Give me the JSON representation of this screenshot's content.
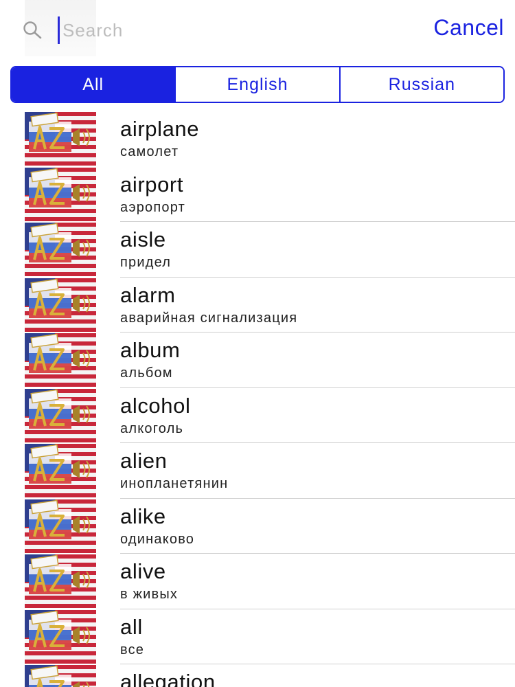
{
  "search": {
    "placeholder": "Search",
    "value": "",
    "cancel_label": "Cancel"
  },
  "segments": [
    {
      "label": "All",
      "selected": true
    },
    {
      "label": "English",
      "selected": false
    },
    {
      "label": "Russian",
      "selected": false
    }
  ],
  "colors": {
    "accent": "#1a22e0",
    "divider": "#cfcfcf",
    "text": "#111111"
  },
  "thumbnail_icon": "az-dictionary-flag-icon",
  "words": [
    {
      "word": "airplane",
      "translation": "самолет"
    },
    {
      "word": "airport",
      "translation": "аэропорт"
    },
    {
      "word": "aisle",
      "translation": "придел"
    },
    {
      "word": "alarm",
      "translation": "аварийная сигнализация"
    },
    {
      "word": "album",
      "translation": "альбом"
    },
    {
      "word": "alcohol",
      "translation": "алкоголь"
    },
    {
      "word": "alien",
      "translation": "инопланетянин"
    },
    {
      "word": "alike",
      "translation": "одинаково"
    },
    {
      "word": "alive",
      "translation": "в живых"
    },
    {
      "word": "all",
      "translation": "все"
    },
    {
      "word": "allegation",
      "translation": ""
    }
  ]
}
